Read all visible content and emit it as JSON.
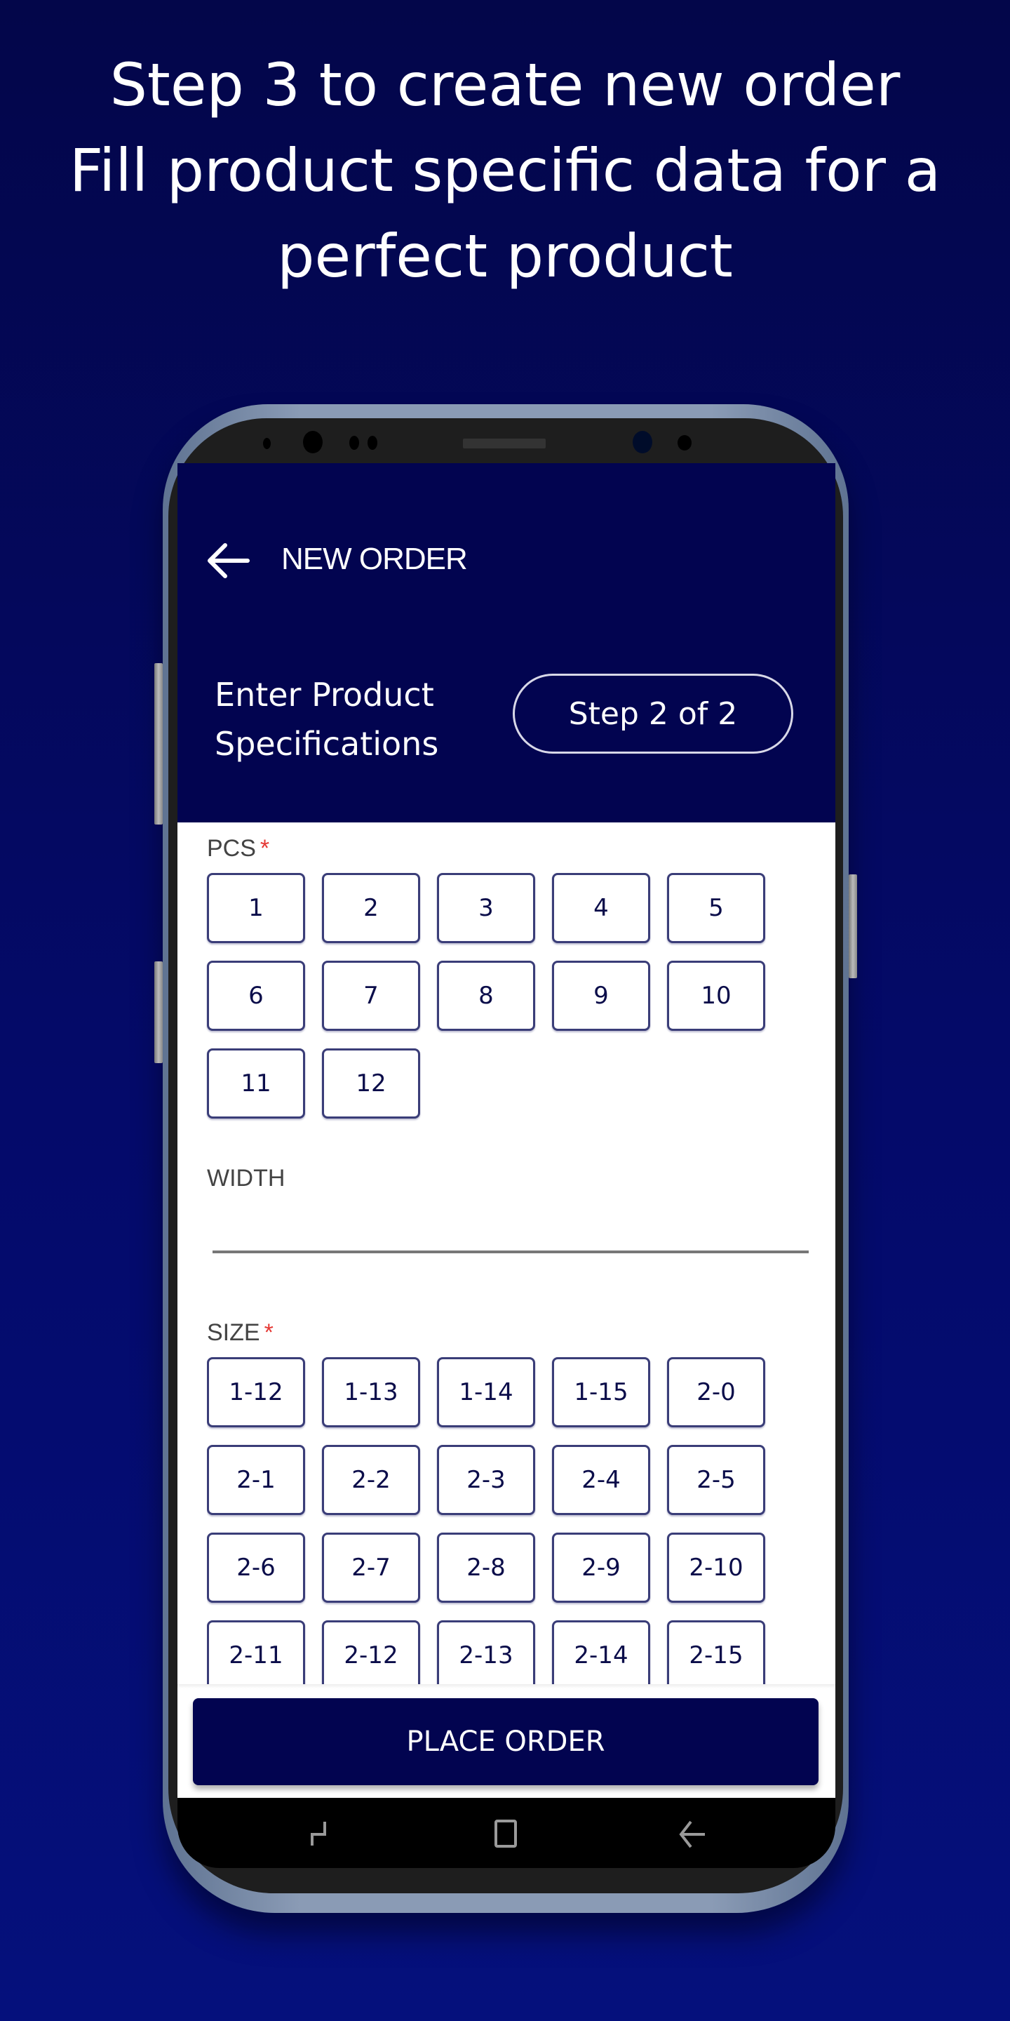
{
  "headline": {
    "lines": [
      "Step 3 to create new order",
      "Fill product specific data for a",
      "perfect product"
    ]
  },
  "colors": {
    "brand": "#020450",
    "chip_border": "#3a3d78",
    "required": "#e53935"
  },
  "app": {
    "header": {
      "back_icon": "arrow-left-icon",
      "title": "NEW ORDER",
      "subtitle_line1": "Enter Product",
      "subtitle_line2": "Specifications",
      "step": "Step 2 of 2"
    },
    "pcs": {
      "label": "PCS",
      "required_mark": "*",
      "options": [
        "1",
        "2",
        "3",
        "4",
        "5",
        "6",
        "7",
        "8",
        "9",
        "10",
        "11",
        "12"
      ]
    },
    "width": {
      "label": "WIDTH",
      "value": "",
      "placeholder": ""
    },
    "size": {
      "label": "SIZE",
      "required_mark": "*",
      "options": [
        "1-12",
        "1-13",
        "1-14",
        "1-15",
        "2-0",
        "2-1",
        "2-2",
        "2-3",
        "2-4",
        "2-5",
        "2-6",
        "2-7",
        "2-8",
        "2-9",
        "2-10",
        "2-11",
        "2-12",
        "2-13",
        "2-14",
        "2-15"
      ]
    },
    "place_order_label": "PLACE ORDER"
  },
  "system_nav": {
    "buttons": [
      "recent-apps-icon",
      "home-icon",
      "back-icon"
    ]
  }
}
